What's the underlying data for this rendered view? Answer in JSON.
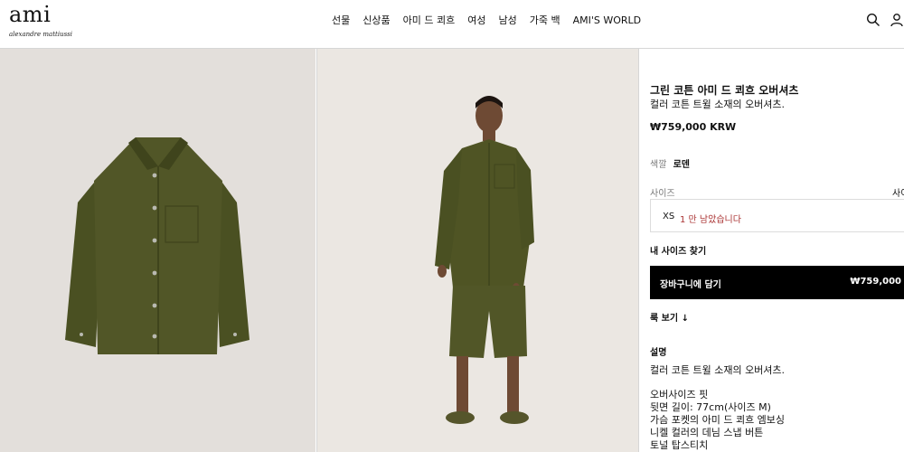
{
  "brand": {
    "logo_text": "ami",
    "logo_subtext": "alexandre mattiussi"
  },
  "nav": {
    "items": [
      "선물",
      "신상품",
      "아미 드 쾨흐",
      "여성",
      "남성",
      "가죽 백",
      "AMI'S WORLD"
    ]
  },
  "header_icons": [
    "search-icon",
    "account-icon"
  ],
  "images": {
    "left_alt": "shirt-product-image",
    "middle_alt": "model-wearing-shirt-image",
    "garment_color": "#4f5424",
    "shoe_color": "#55552b"
  },
  "product": {
    "title": "그린 코튼 아미 드 쾨흐 오버셔츠",
    "subtitle": "컬러 코튼 트윌 소재의 오버셔츠.",
    "price": "₩759,000 KRW",
    "color_label": "색깔",
    "color_value": "로덴",
    "size_label": "사이즈",
    "size_guide_label": "사이",
    "size_option": "XS",
    "size_stock": "1 만 남았습니다",
    "find_size": "내 사이즈 찾기",
    "cart_label": "장바구니에 담기",
    "cart_price": "₩759,000",
    "look_link": "룩 보기 ↓",
    "description_heading": "설명",
    "description_text": "컬러 코튼 트윌 소재의 오버셔츠.",
    "details": [
      "오버사이즈 핏",
      "뒷면 길이: 77cm(사이즈 M)",
      "가슴 포켓의 아미 드 쾨흐 엠보싱",
      "니켈 컬러의 데님 스냅 버튼",
      "토널 탑스티치"
    ]
  },
  "colors": {
    "accent_black": "#000000",
    "stock_red": "#aa3333",
    "border": "#d6d6d6"
  }
}
